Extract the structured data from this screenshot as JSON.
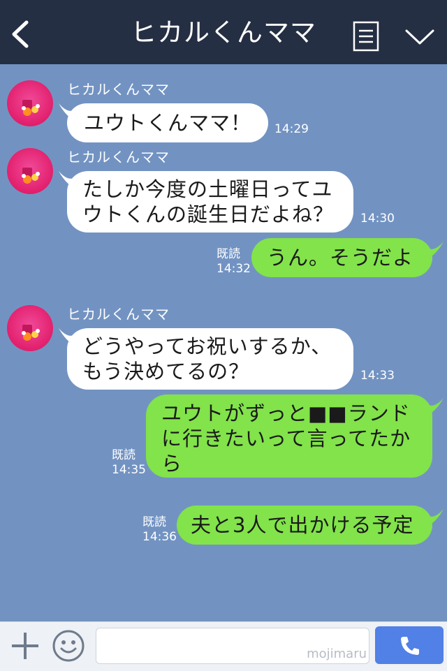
{
  "header": {
    "title": "ヒカルくんママ",
    "back_icon": "chevron-left-icon",
    "menu_icon": "menu-list-icon",
    "collapse_icon": "chevron-down-icon"
  },
  "colors": {
    "header_bg": "#252f43",
    "chat_bg": "#7293c2",
    "incoming_bubble": "#ffffff",
    "outgoing_bubble": "#82e34a",
    "call_button": "#5180e6",
    "avatar_pink": "#e3226f"
  },
  "messages": [
    {
      "from": "other",
      "sender": "ヒカルくんママ",
      "lines": [
        "ユウトくんママ！"
      ],
      "time": "14:29"
    },
    {
      "from": "other",
      "sender": "ヒカルくんママ",
      "lines": [
        "たしか今度の土曜日ってユ",
        "ウトくんの誕生日だよね？"
      ],
      "time": "14:30"
    },
    {
      "from": "me",
      "read": "既読",
      "lines": [
        "うん。そうだよ"
      ],
      "time": "14:32"
    },
    {
      "from": "other",
      "sender": "ヒカルくんママ",
      "lines": [
        "どうやってお祝いするか、",
        "もう決めてるの？"
      ],
      "time": "14:33"
    },
    {
      "from": "me",
      "read": "既読",
      "lines": [
        "ユウトがずっと■■ランド",
        "に行きたいって言ってたか",
        "ら"
      ],
      "time": "14:35"
    },
    {
      "from": "me",
      "read": "既読",
      "lines": [
        "夫と3人で出かける予定"
      ],
      "time": "14:36"
    }
  ],
  "input": {
    "placeholder": "",
    "watermark": "mojimaru",
    "plus_icon": "plus-icon",
    "emoji_icon": "smiley-icon",
    "call_icon": "phone-icon"
  }
}
